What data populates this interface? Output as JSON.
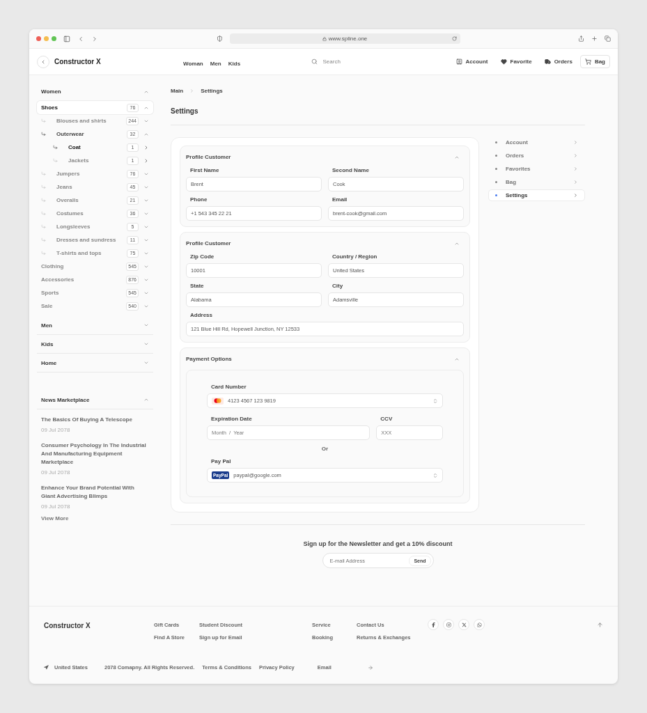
{
  "browser": {
    "url": "www.spline.one"
  },
  "header": {
    "logo": "Constructor X",
    "nav": [
      "Woman",
      "Men",
      "Kids"
    ],
    "search": {
      "placeholder": "Search"
    },
    "actions": [
      {
        "kind": "account",
        "label": "Account"
      },
      {
        "kind": "favorite",
        "label": "Favorite"
      },
      {
        "kind": "orders",
        "label": "Orders"
      },
      {
        "kind": "bag",
        "label": "Bag"
      }
    ]
  },
  "sidebar": {
    "sections": [
      {
        "title": "Women",
        "expanded": true,
        "items": [
          {
            "label": "Shoes",
            "count": "76",
            "expanded": true,
            "selected": true,
            "children": [
              {
                "label": "Blouses and shirts",
                "count": "244",
                "expanded": false,
                "selected": false
              },
              {
                "label": "Outerwear",
                "count": "32",
                "expanded": true,
                "selected": false,
                "children": [
                  {
                    "label": "Coat",
                    "count": "1",
                    "selected": true
                  },
                  {
                    "label": "Jackets",
                    "count": "1",
                    "selected": false
                  }
                ]
              },
              {
                "label": "Jumpers",
                "count": "76",
                "expanded": false,
                "selected": false
              },
              {
                "label": "Jeans",
                "count": "45",
                "expanded": false,
                "selected": false
              },
              {
                "label": "Overalls",
                "count": "21",
                "expanded": false,
                "selected": false
              },
              {
                "label": "Costumes",
                "count": "36",
                "expanded": false,
                "selected": false
              },
              {
                "label": "Longsleeves",
                "count": "5",
                "expanded": false,
                "selected": false
              },
              {
                "label": "Dresses and sundress",
                "count": "11",
                "expanded": false,
                "selected": false
              },
              {
                "label": "T-shirts and tops",
                "count": "75",
                "expanded": false,
                "selected": false
              }
            ]
          },
          {
            "label": "Clothing",
            "count": "545",
            "expanded": false,
            "selected": false
          },
          {
            "label": "Accessories",
            "count": "876",
            "expanded": false,
            "selected": false
          },
          {
            "label": "Sports",
            "count": "545",
            "expanded": false,
            "selected": false
          },
          {
            "label": "Sale",
            "count": "540",
            "expanded": false,
            "selected": false
          }
        ]
      },
      {
        "title": "Men",
        "expanded": false
      },
      {
        "title": "Kids",
        "expanded": false
      },
      {
        "title": "Home",
        "expanded": false
      }
    ],
    "news": {
      "title": "News Marketplace",
      "expanded": true,
      "articles": [
        {
          "title": "The Basics Of Buying A Telescope",
          "date": "09 Jul 2078"
        },
        {
          "title": "Consumer Psychology In The Industrial And Manufacturing Equipment Marketplace",
          "date": "09 Jul 2078"
        },
        {
          "title": "Enhance Your Brand Potential With Giant Advertising Blimps",
          "date": "09 Jul 2078"
        }
      ],
      "more": "View More"
    }
  },
  "breadcrumb": [
    "Main",
    "Settings"
  ],
  "title": "Settings",
  "sections": [
    {
      "kind": "fields",
      "title": "Profile Customer",
      "expanded": true,
      "rows": [
        [
          {
            "label": "First Name",
            "value": "Brent"
          },
          {
            "label": "Second Name",
            "value": "Cook"
          }
        ],
        [
          {
            "label": "Phone",
            "value": "+1 543 345 22 21"
          },
          {
            "label": "Email",
            "value": "brent-cook@gmail.com"
          }
        ]
      ]
    },
    {
      "kind": "fields",
      "title": "Profile Customer",
      "expanded": true,
      "rows": [
        [
          {
            "label": "Zip Code",
            "value": "10001"
          },
          {
            "label": "Country / Region",
            "value": "United States"
          }
        ],
        [
          {
            "label": "State",
            "value": "Alabama"
          },
          {
            "label": "City",
            "value": "Adamsville"
          }
        ],
        [
          {
            "label": "Address",
            "value": "121 Blue Hill Rd, Hopewell Junction, NY 12533"
          }
        ]
      ]
    },
    {
      "kind": "payment",
      "title": "Payment Options",
      "expanded": true,
      "card": {
        "label": "Card Number",
        "value": "4123 4567 123 9819"
      },
      "expiration": {
        "label": "Expiration Date",
        "placeholder": "Month  /  Year"
      },
      "ccv": {
        "label": "CCV",
        "placeholder": "XXX"
      },
      "separator": "Or",
      "paypal": {
        "label": "Pay Pal",
        "badge": "PayPal",
        "value": "paypal@google.com"
      }
    }
  ],
  "settings_nav": [
    {
      "label": "Account",
      "selected": false
    },
    {
      "label": "Orders",
      "selected": false
    },
    {
      "label": "Favorites",
      "selected": false
    },
    {
      "label": "Bag",
      "selected": false
    },
    {
      "label": "Settings",
      "selected": true
    }
  ],
  "newsletter": {
    "title": "Sign up for the Newsletter and get a 10% discount",
    "placeholder": "E-mail Address",
    "button": "Send"
  },
  "footer": {
    "logo": "Constructor X",
    "link_groups": [
      [
        "Gift Cards",
        "Find A Store"
      ],
      [
        "Student Discount",
        "Sign up for Email"
      ],
      [
        "Service",
        "Booking"
      ],
      [
        "Contact Us",
        "Returns & Exchanges"
      ]
    ],
    "country": "United States",
    "copyright": "2078 Comapny. All Rights Reserved.",
    "links": [
      "Terms & Conditions",
      "Privacy Policy"
    ],
    "email": {
      "placeholder": "Email"
    }
  }
}
